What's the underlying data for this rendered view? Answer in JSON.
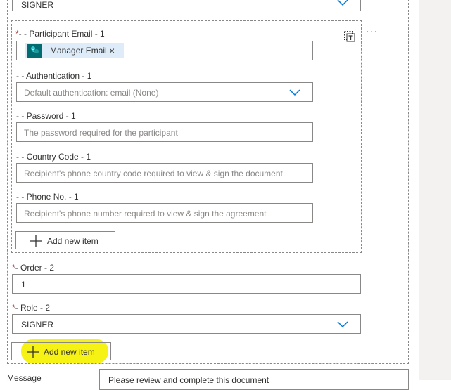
{
  "top_role": {
    "value": "SIGNER"
  },
  "participant": {
    "email_label_req": "*",
    "email_label": "- - Participant Email - 1",
    "email_chip": "Manager Email",
    "email_chip_remove": "×",
    "auth_label": "- - Authentication - 1",
    "auth_placeholder": "Default authentication: email (None)",
    "password_label": "- - Password - 1",
    "password_placeholder": "The password required for the participant",
    "country_label": "- - Country Code - 1",
    "country_placeholder": "Recipient's phone country code required to view & sign the document",
    "phone_label": "- - Phone No. - 1",
    "phone_placeholder": "Recipient's phone number required to view & sign the agreement",
    "add_item_label": "Add new item",
    "more_label": "···"
  },
  "order": {
    "label_req": "*",
    "label": "- Order - 2",
    "value": "1"
  },
  "role": {
    "label_req": "*",
    "label": "- Role - 2",
    "value": "SIGNER"
  },
  "add_item_label": "Add new item",
  "message": {
    "label": "Message",
    "value": "Please review and complete this document"
  },
  "colors": {
    "accent": "#0078d4",
    "highlight": "#f6f214",
    "chip_bg": "#deecf9",
    "sharepoint": "#036c70",
    "required": "#a4262c"
  }
}
